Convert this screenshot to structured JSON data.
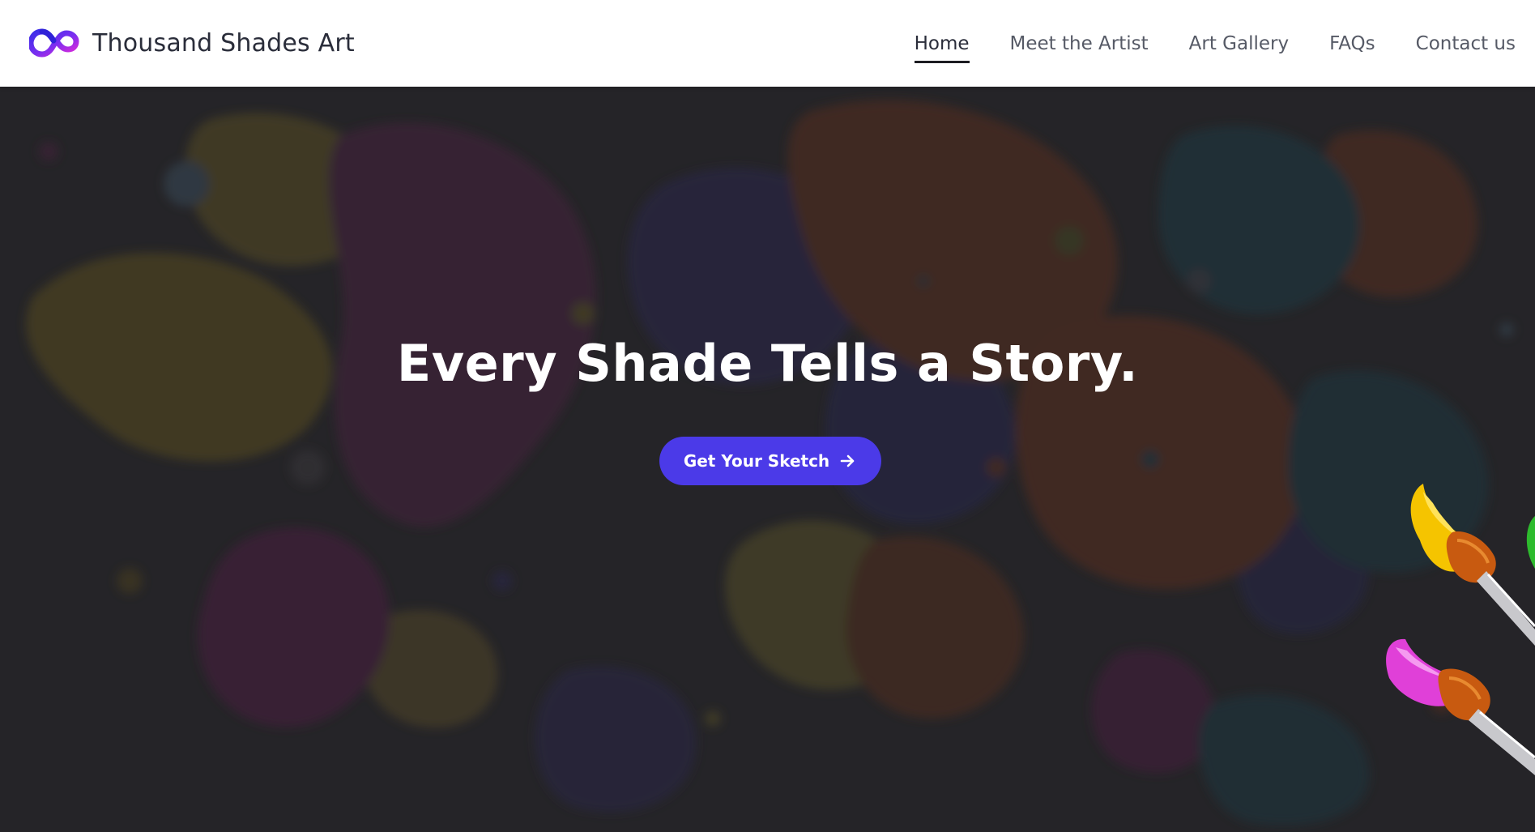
{
  "brand": {
    "name": "Thousand Shades Art",
    "logo_icon": "infinity-logo-icon"
  },
  "nav": {
    "items": [
      {
        "label": "Home",
        "active": true
      },
      {
        "label": "Meet the Artist",
        "active": false
      },
      {
        "label": "Art Gallery",
        "active": false
      },
      {
        "label": "FAQs",
        "active": false
      },
      {
        "label": "Contact us",
        "active": false
      }
    ]
  },
  "hero": {
    "title": "Every Shade Tells a Story.",
    "cta_label": "Get Your Sketch",
    "cta_icon": "arrow-right-icon",
    "decoration_icon": "paintbrushes-icon"
  },
  "colors": {
    "accent": "#4b3ae8",
    "nav_text": "#565a66",
    "brand_text": "#2a2d3a",
    "hero_bg": "#2a292b"
  }
}
